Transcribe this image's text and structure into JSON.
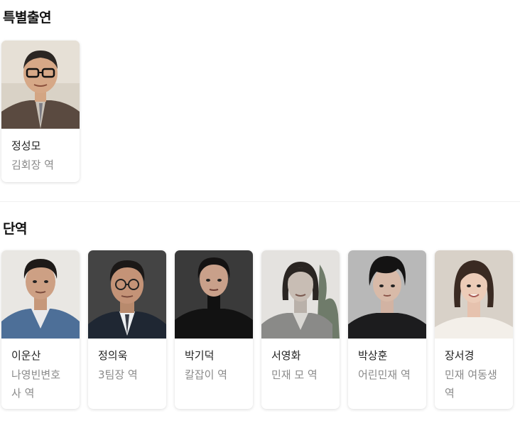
{
  "special": {
    "title": "특별출연",
    "cast": [
      {
        "name": "정성모",
        "role": "김회장 역"
      }
    ]
  },
  "cameo": {
    "title": "단역",
    "cast": [
      {
        "name": "이운산",
        "role": "나영빈변호사 역"
      },
      {
        "name": "정의욱",
        "role": "3팀장 역"
      },
      {
        "name": "박기덕",
        "role": "칼잡이 역"
      },
      {
        "name": "서영화",
        "role": "민재 모 역"
      },
      {
        "name": "박상훈",
        "role": "어린민재 역"
      },
      {
        "name": "장서경",
        "role": "민재 여동생 역"
      }
    ]
  }
}
